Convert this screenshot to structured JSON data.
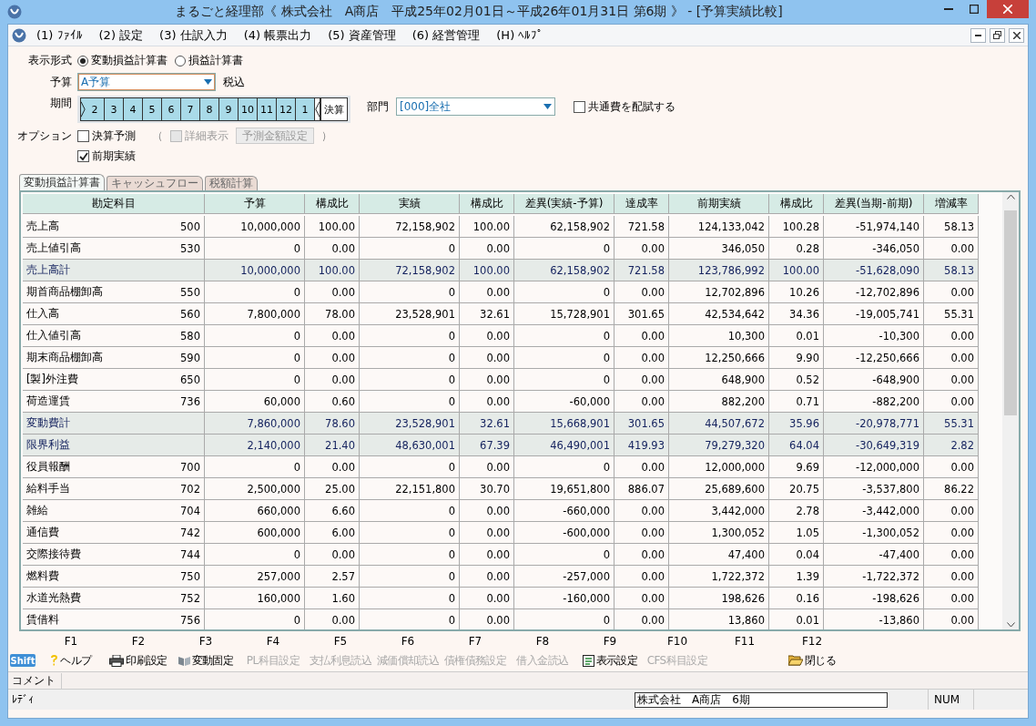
{
  "window": {
    "title": "まるごと経理部《 株式会社　A商店　平成25年02月01日～平成26年01月31日 第6期 》 - [予算実績比較]"
  },
  "menu": [
    {
      "key": "(1)",
      "label": "ﾌｧｲﾙ"
    },
    {
      "key": "(2)",
      "label": "設定"
    },
    {
      "key": "(3)",
      "label": "仕訳入力"
    },
    {
      "key": "(4)",
      "label": "帳票出力"
    },
    {
      "key": "(5)",
      "label": "資産管理"
    },
    {
      "key": "(6)",
      "label": "経営管理"
    },
    {
      "key": "(H)",
      "label": "ﾍﾙﾌﾟ"
    }
  ],
  "display_format": {
    "label": "表示形式",
    "options": [
      {
        "label": "変動損益計算書",
        "selected": true
      },
      {
        "label": "損益計算書",
        "selected": false
      }
    ]
  },
  "budget": {
    "label": "予算",
    "value": "A予算",
    "note": "税込"
  },
  "period": {
    "label": "期間",
    "months": [
      "2",
      "3",
      "4",
      "5",
      "6",
      "7",
      "8",
      "9",
      "10",
      "11",
      "12",
      "1"
    ],
    "settlement": "決算"
  },
  "department": {
    "label": "部門",
    "value": "[000]全社"
  },
  "allocate": {
    "label": "共通費を配賦する",
    "checked": false
  },
  "options": {
    "label": "オプション",
    "forecast": {
      "label": "決算予測",
      "checked": false
    },
    "open_paren": "（",
    "detail": {
      "label": "詳細表示",
      "checked": false,
      "disabled": true
    },
    "forecast_button": {
      "label": "予測金額設定",
      "disabled": true
    },
    "close_paren": "）",
    "previous": {
      "label": "前期実績",
      "checked": true
    }
  },
  "tabs": [
    {
      "label": "変動損益計算書",
      "selected": true
    },
    {
      "label": "キャッシュフロー",
      "selected": false
    },
    {
      "label": "税額計算",
      "selected": false
    }
  ],
  "table": {
    "columns": [
      "勘定科目",
      "予算",
      "構成比",
      "実績",
      "構成比",
      "差異(実績-予算)",
      "達成率",
      "前期実績",
      "構成比",
      "差異(当期-前期)",
      "増減率"
    ],
    "rows": [
      {
        "kind": "account",
        "name": "売上高",
        "code": "500",
        "values": [
          "10,000,000",
          "100.00",
          "72,158,902",
          "100.00",
          "62,158,902",
          "721.58",
          "124,133,042",
          "100.28",
          "-51,974,140",
          "58.13"
        ]
      },
      {
        "kind": "account",
        "name": "売上値引高",
        "code": "530",
        "values": [
          "0",
          "0.00",
          "0",
          "0.00",
          "0",
          "0.00",
          "346,050",
          "0.28",
          "-346,050",
          "0.00"
        ]
      },
      {
        "kind": "total",
        "name": "売上高計",
        "code": "",
        "values": [
          "10,000,000",
          "100.00",
          "72,158,902",
          "100.00",
          "62,158,902",
          "721.58",
          "123,786,992",
          "100.00",
          "-51,628,090",
          "58.13"
        ]
      },
      {
        "kind": "account",
        "name": "期首商品棚卸高",
        "code": "550",
        "values": [
          "0",
          "0.00",
          "0",
          "0.00",
          "0",
          "0.00",
          "12,702,896",
          "10.26",
          "-12,702,896",
          "0.00"
        ]
      },
      {
        "kind": "account",
        "name": "仕入高",
        "code": "560",
        "values": [
          "7,800,000",
          "78.00",
          "23,528,901",
          "32.61",
          "15,728,901",
          "301.65",
          "42,534,642",
          "34.36",
          "-19,005,741",
          "55.31"
        ]
      },
      {
        "kind": "account",
        "name": "仕入値引高",
        "code": "580",
        "values": [
          "0",
          "0.00",
          "0",
          "0.00",
          "0",
          "0.00",
          "10,300",
          "0.01",
          "-10,300",
          "0.00"
        ]
      },
      {
        "kind": "account",
        "name": "期末商品棚卸高",
        "code": "590",
        "values": [
          "0",
          "0.00",
          "0",
          "0.00",
          "0",
          "0.00",
          "12,250,666",
          "9.90",
          "-12,250,666",
          "0.00"
        ]
      },
      {
        "kind": "account",
        "name": "[製]外注費",
        "code": "650",
        "values": [
          "0",
          "0.00",
          "0",
          "0.00",
          "0",
          "0.00",
          "648,900",
          "0.52",
          "-648,900",
          "0.00"
        ]
      },
      {
        "kind": "account",
        "name": "荷造運賃",
        "code": "736",
        "values": [
          "60,000",
          "0.60",
          "0",
          "0.00",
          "-60,000",
          "0.00",
          "882,200",
          "0.71",
          "-882,200",
          "0.00"
        ]
      },
      {
        "kind": "total",
        "name": "変動費計",
        "code": "",
        "values": [
          "7,860,000",
          "78.60",
          "23,528,901",
          "32.61",
          "15,668,901",
          "301.65",
          "44,507,672",
          "35.96",
          "-20,978,771",
          "55.31"
        ]
      },
      {
        "kind": "total",
        "name": "限界利益",
        "code": "",
        "values": [
          "2,140,000",
          "21.40",
          "48,630,001",
          "67.39",
          "46,490,001",
          "419.93",
          "79,279,320",
          "64.04",
          "-30,649,319",
          "2.82"
        ]
      },
      {
        "kind": "account",
        "name": "役員報酬",
        "code": "700",
        "values": [
          "0",
          "0.00",
          "0",
          "0.00",
          "0",
          "0.00",
          "12,000,000",
          "9.69",
          "-12,000,000",
          "0.00"
        ]
      },
      {
        "kind": "account",
        "name": "給料手当",
        "code": "702",
        "values": [
          "2,500,000",
          "25.00",
          "22,151,800",
          "30.70",
          "19,651,800",
          "886.07",
          "25,689,600",
          "20.75",
          "-3,537,800",
          "86.22"
        ]
      },
      {
        "kind": "account",
        "name": "雑給",
        "code": "704",
        "values": [
          "660,000",
          "6.60",
          "0",
          "0.00",
          "-660,000",
          "0.00",
          "3,442,000",
          "2.78",
          "-3,442,000",
          "0.00"
        ]
      },
      {
        "kind": "account",
        "name": "通信費",
        "code": "742",
        "values": [
          "600,000",
          "6.00",
          "0",
          "0.00",
          "-600,000",
          "0.00",
          "1,300,052",
          "1.05",
          "-1,300,052",
          "0.00"
        ]
      },
      {
        "kind": "account",
        "name": "交際接待費",
        "code": "744",
        "values": [
          "0",
          "0.00",
          "0",
          "0.00",
          "0",
          "0.00",
          "47,400",
          "0.04",
          "-47,400",
          "0.00"
        ]
      },
      {
        "kind": "account",
        "name": "燃料費",
        "code": "750",
        "values": [
          "257,000",
          "2.57",
          "0",
          "0.00",
          "-257,000",
          "0.00",
          "1,722,372",
          "1.39",
          "-1,722,372",
          "0.00"
        ]
      },
      {
        "kind": "account",
        "name": "水道光熱費",
        "code": "752",
        "values": [
          "160,000",
          "1.60",
          "0",
          "0.00",
          "-160,000",
          "0.00",
          "198,626",
          "0.16",
          "-198,626",
          "0.00"
        ]
      },
      {
        "kind": "account",
        "name": "賃借料",
        "code": "756",
        "values": [
          "0",
          "0.00",
          "0",
          "0.00",
          "0",
          "0.00",
          "13,860",
          "0.01",
          "-13,860",
          "0.00"
        ]
      }
    ]
  },
  "function_keys": {
    "shift": "Shift",
    "keys": [
      {
        "key": "F1",
        "label": "ヘルプ",
        "disabled": false
      },
      {
        "key": "F2",
        "label": "印刷設定",
        "disabled": false
      },
      {
        "key": "F3",
        "label": "変動固定",
        "disabled": false
      },
      {
        "key": "F4",
        "label": "PL科目設定",
        "disabled": true
      },
      {
        "key": "F5",
        "label": "支払利息読込",
        "disabled": true
      },
      {
        "key": "F6",
        "label": "減価償却読込",
        "disabled": true
      },
      {
        "key": "F7",
        "label": "債権債務設定",
        "disabled": true
      },
      {
        "key": "F8",
        "label": "借入金読込",
        "disabled": true
      },
      {
        "key": "F9",
        "label": "表示設定",
        "disabled": false
      },
      {
        "key": "F10",
        "label": "CFS科目設定",
        "disabled": true
      },
      {
        "key": "F11"
      },
      {
        "key": "F12",
        "label": "閉じる",
        "disabled": false
      }
    ]
  },
  "comment": {
    "label": "コメント"
  },
  "status_bar": {
    "state": "ﾚﾃﾞｨ",
    "company": "株式会社　A商店　6期",
    "num": "NUM"
  }
}
